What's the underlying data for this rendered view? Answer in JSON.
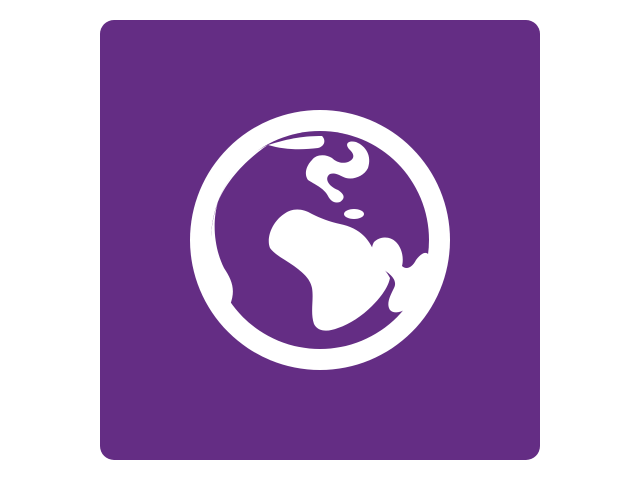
{
  "app_icon": {
    "icon": "globe-icon",
    "background_color": "#642d84",
    "foreground_color": "#ffffff"
  }
}
